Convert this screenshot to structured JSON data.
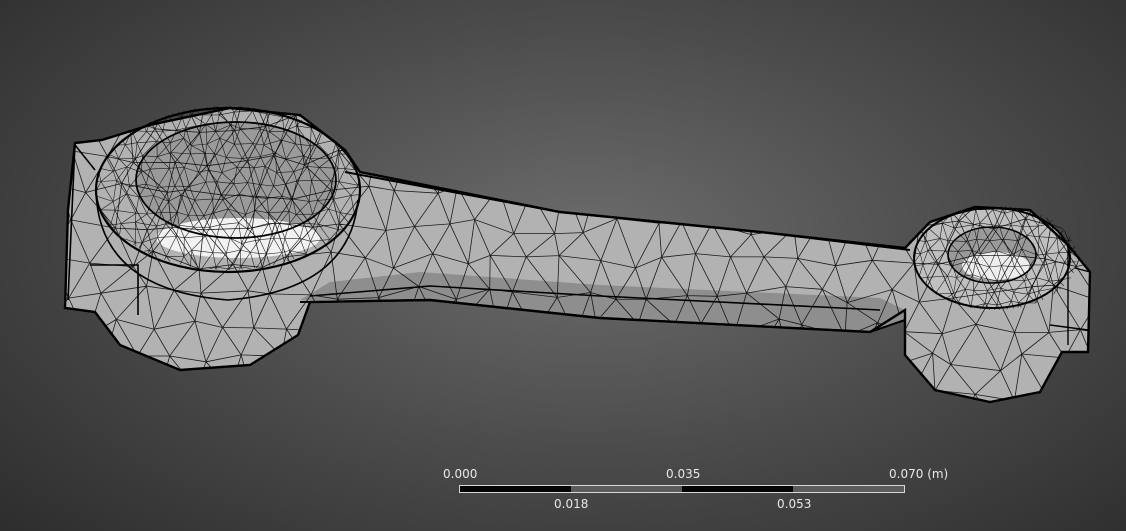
{
  "viewport": {
    "background_center": "#6c6c6c",
    "background_edge": "#2a2a2a",
    "model": {
      "name": "connecting-rod",
      "render_mode": "wireframe-mesh",
      "surface_color": "#b4b4b4",
      "edge_color": "#000000"
    }
  },
  "scale_bar": {
    "unit": "(m)",
    "top_labels": [
      "0.000",
      "0.035",
      "0.070"
    ],
    "bottom_labels": [
      "0.018",
      "0.053"
    ],
    "segment_colors": [
      "#050505",
      "#5c5c5c",
      "#050505",
      "#5c5c5c"
    ]
  }
}
